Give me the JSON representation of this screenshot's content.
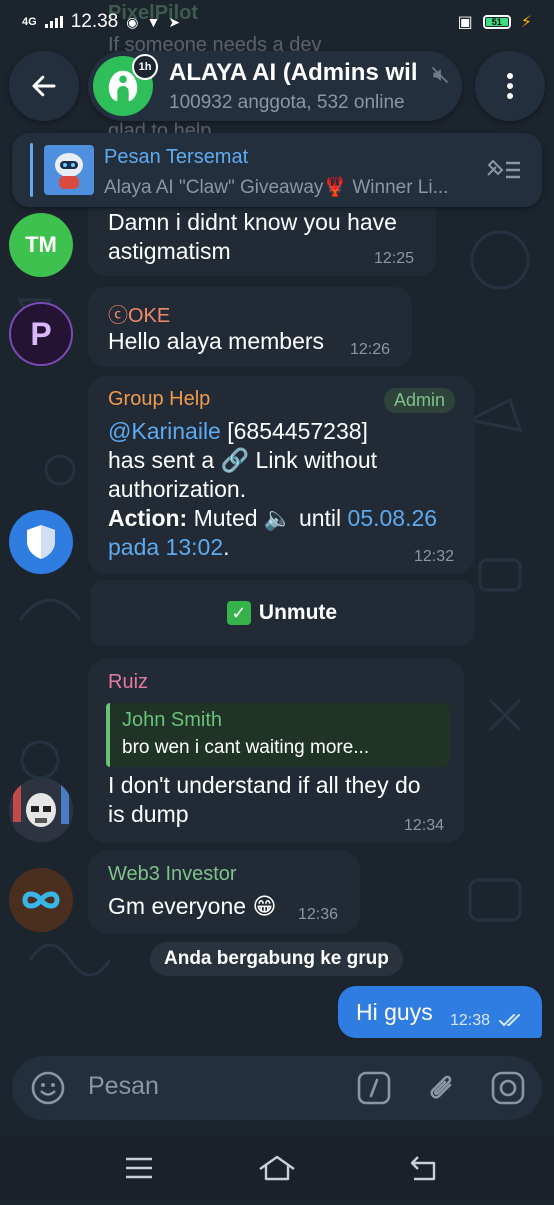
{
  "status_bar": {
    "time": "12.38",
    "network": "4G",
    "battery": "51"
  },
  "background_ghost": {
    "name": "PixelPilot",
    "line1": "If someone needs a dev",
    "line2": "glad to help"
  },
  "header": {
    "title": "ALAYA AI (Admins wil",
    "subtitle": "100932 anggota, 532 online",
    "avatar_badge": "1h"
  },
  "pinned": {
    "label": "Pesan Tersemat",
    "text": "Alaya AI \"Claw\" Giveaway🦞 Winner Li..."
  },
  "messages": [
    {
      "avatar_initials": "TM",
      "avatar_color": "#3ec14f",
      "line1": "Damn i didnt know you have",
      "line2": "astigmatism",
      "time": "12:25"
    },
    {
      "sender": "ⓒOKE",
      "sender_color": "#ef8a6b",
      "text": "Hello alaya members",
      "time": "12:26"
    },
    {
      "sender": "Group Help",
      "sender_color": "#ef9a4c",
      "badge": "Admin",
      "mention": "@Karinaile",
      "id": "[6854457238]",
      "line2": "has sent a 🔗 Link without",
      "line3": "authorization.",
      "action_label": "Action:",
      "action_text": "Muted 🔈 until",
      "until_date": "05.08.26",
      "until_time": "pada 13:02",
      "time": "12:32"
    },
    {
      "sender": "Ruiz",
      "sender_color": "#e57aa0",
      "reply_name": "John Smith",
      "reply_text": "bro wen i cant waiting more...",
      "line1": "I don't understand if all they do",
      "line2": "is dump",
      "time": "12:34"
    },
    {
      "sender": "Web3 Investor",
      "sender_color": "#7ec28a",
      "text": "Gm everyone 😁",
      "time": "12:36"
    }
  ],
  "unmute_button": "Unmute",
  "service_message": "Anda bergabung ke grup",
  "outgoing": {
    "text": "Hi guys",
    "time": "12:38"
  },
  "composer": {
    "placeholder": "Pesan"
  },
  "icons": [
    "back-arrow-icon",
    "more-vertical-icon",
    "mute-icon",
    "unpin-list-icon",
    "emoji-icon",
    "slash-command-icon",
    "attach-icon",
    "camera-icon",
    "menu-icon",
    "home-icon",
    "back-nav-icon",
    "double-check-icon"
  ],
  "colors": {
    "background": "#1c242e",
    "bubble": "#222b35",
    "outgoing_bubble": "#2f7de1",
    "link": "#5eaaf0",
    "header": "#242f3d"
  }
}
